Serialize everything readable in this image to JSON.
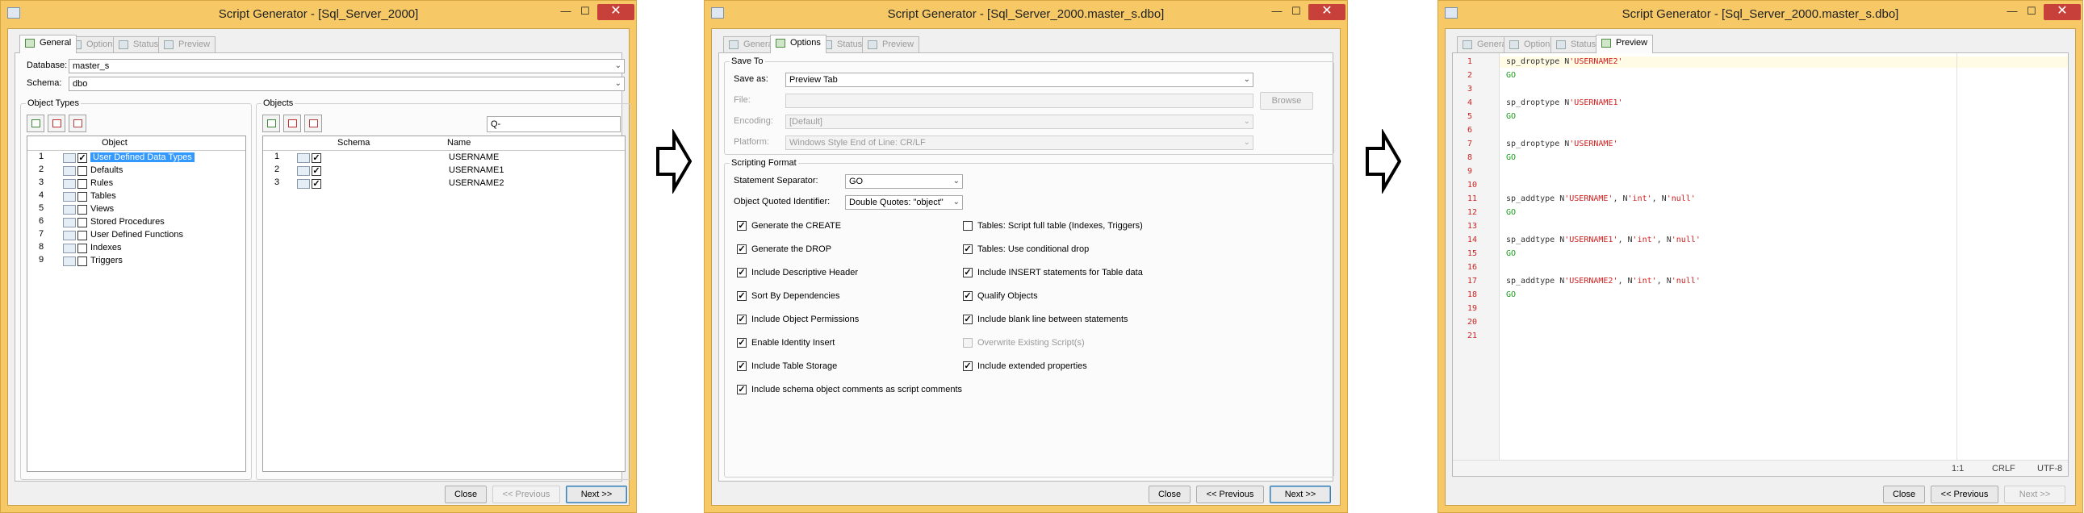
{
  "window1": {
    "title": "Script Generator - [Sql_Server_2000]",
    "tabs": [
      "General",
      "Options",
      "Status",
      "Preview"
    ],
    "database_label": "Database:",
    "database_value": "master_s",
    "schema_label": "Schema:",
    "schema_value": "dbo",
    "object_types": {
      "title": "Object Types",
      "column_header": "Object",
      "rows": [
        {
          "num": "1",
          "label": "User Defined Data Types",
          "checked": true
        },
        {
          "num": "2",
          "label": "Defaults",
          "checked": false
        },
        {
          "num": "3",
          "label": "Rules",
          "checked": false
        },
        {
          "num": "4",
          "label": "Tables",
          "checked": false
        },
        {
          "num": "5",
          "label": "Views",
          "checked": false
        },
        {
          "num": "6",
          "label": "Stored Procedures",
          "checked": false
        },
        {
          "num": "7",
          "label": "User Defined Functions",
          "checked": false
        },
        {
          "num": "8",
          "label": "Indexes",
          "checked": false
        },
        {
          "num": "9",
          "label": "Triggers",
          "checked": false
        }
      ]
    },
    "objects": {
      "title": "Objects",
      "search_placeholder": "Q-",
      "columns": [
        "Schema",
        "Name"
      ],
      "rows": [
        {
          "num": "1",
          "name": "USERNAME"
        },
        {
          "num": "2",
          "name": "USERNAME1"
        },
        {
          "num": "3",
          "name": "USERNAME2"
        }
      ]
    },
    "buttons": {
      "close": "Close",
      "previous": "<< Previous",
      "next": "Next >>"
    }
  },
  "window2": {
    "title": "Script Generator - [Sql_Server_2000.master_s.dbo]",
    "tabs": [
      "General",
      "Options",
      "Status",
      "Preview"
    ],
    "save_to": {
      "title": "Save To",
      "save_as_label": "Save as:",
      "save_as_value": "Preview Tab",
      "file_label": "File:",
      "browse": "Browse",
      "encoding_label": "Encoding:",
      "encoding_value": "[Default]",
      "platform_label": "Platform:",
      "platform_value": "Windows Style End of Line: CR/LF"
    },
    "scripting": {
      "title": "Scripting Format",
      "separator_label": "Statement Separator:",
      "separator_value": "GO",
      "quoted_label": "Object Quoted Identifier:",
      "quoted_value": "Double Quotes: \"object\"",
      "left_options": [
        {
          "label": "Generate the CREATE",
          "checked": true
        },
        {
          "label": "Generate the DROP",
          "checked": true
        },
        {
          "label": "Include Descriptive Header",
          "checked": true
        },
        {
          "label": "Sort By Dependencies",
          "checked": true
        },
        {
          "label": "Include Object Permissions",
          "checked": true
        },
        {
          "label": "Enable Identity Insert",
          "checked": true
        },
        {
          "label": "Include Table Storage",
          "checked": true
        },
        {
          "label": "Include schema object comments as script comments",
          "checked": true
        }
      ],
      "right_options": [
        {
          "label": "Tables: Script full table (Indexes, Triggers)",
          "checked": false,
          "disabled": false
        },
        {
          "label": "Tables: Use conditional drop",
          "checked": true,
          "disabled": false
        },
        {
          "label": "Include INSERT statements for Table data",
          "checked": true,
          "disabled": false
        },
        {
          "label": "Qualify Objects",
          "checked": true,
          "disabled": false
        },
        {
          "label": "Include blank line between statements",
          "checked": true,
          "disabled": false
        },
        {
          "label": "Overwrite Existing Script(s)",
          "checked": false,
          "disabled": true
        },
        {
          "label": "Include extended properties",
          "checked": true,
          "disabled": false
        }
      ]
    },
    "buttons": {
      "close": "Close",
      "previous": "<< Previous",
      "next": "Next >>"
    }
  },
  "window3": {
    "title": "Script Generator - [Sql_Server_2000.master_s.dbo]",
    "tabs": [
      "General",
      "Options",
      "Status",
      "Preview"
    ],
    "line_numbers": [
      "1",
      "2",
      "3",
      "4",
      "5",
      "6",
      "7",
      "8",
      "9",
      "10",
      "11",
      "12",
      "13",
      "14",
      "15",
      "16",
      "17",
      "18",
      "19",
      "20",
      "21"
    ],
    "code_lines": [
      [
        {
          "t": "sp_droptype N",
          "c": "kw"
        },
        {
          "t": "'USERNAME2'",
          "c": "str"
        }
      ],
      [
        {
          "t": "GO",
          "c": "go"
        }
      ],
      [],
      [
        {
          "t": "sp_droptype N",
          "c": "kw"
        },
        {
          "t": "'USERNAME1'",
          "c": "str"
        }
      ],
      [
        {
          "t": "GO",
          "c": "go"
        }
      ],
      [],
      [
        {
          "t": "sp_droptype N",
          "c": "kw"
        },
        {
          "t": "'USERNAME'",
          "c": "str"
        }
      ],
      [
        {
          "t": "GO",
          "c": "go"
        }
      ],
      [],
      [],
      [
        {
          "t": "sp_addtype N",
          "c": "kw"
        },
        {
          "t": "'USERNAME'",
          "c": "str"
        },
        {
          "t": ", N",
          "c": "kw"
        },
        {
          "t": "'int'",
          "c": "str"
        },
        {
          "t": ", N",
          "c": "kw"
        },
        {
          "t": "'null'",
          "c": "str"
        }
      ],
      [
        {
          "t": "GO",
          "c": "go"
        }
      ],
      [],
      [
        {
          "t": "sp_addtype N",
          "c": "kw"
        },
        {
          "t": "'USERNAME1'",
          "c": "str"
        },
        {
          "t": ", N",
          "c": "kw"
        },
        {
          "t": "'int'",
          "c": "str"
        },
        {
          "t": ", N",
          "c": "kw"
        },
        {
          "t": "'null'",
          "c": "str"
        }
      ],
      [
        {
          "t": "GO",
          "c": "go"
        }
      ],
      [],
      [
        {
          "t": "sp_addtype N",
          "c": "kw"
        },
        {
          "t": "'USERNAME2'",
          "c": "str"
        },
        {
          "t": ", N",
          "c": "kw"
        },
        {
          "t": "'int'",
          "c": "str"
        },
        {
          "t": ", N",
          "c": "kw"
        },
        {
          "t": "'null'",
          "c": "str"
        }
      ],
      [
        {
          "t": "GO",
          "c": "go"
        }
      ],
      [],
      [],
      []
    ],
    "status": {
      "position": "1:1",
      "eol": "CRLF",
      "encoding": "UTF-8"
    },
    "buttons": {
      "close": "Close",
      "previous": "<< Previous",
      "next": "Next >>"
    }
  },
  "colors": {
    "title_bar": "#f6c966",
    "close_button": "#c7413a",
    "selection": "#3399ff",
    "string": "#d42020",
    "go_keyword": "#1a9a1a",
    "line_number": "#cc2222"
  }
}
